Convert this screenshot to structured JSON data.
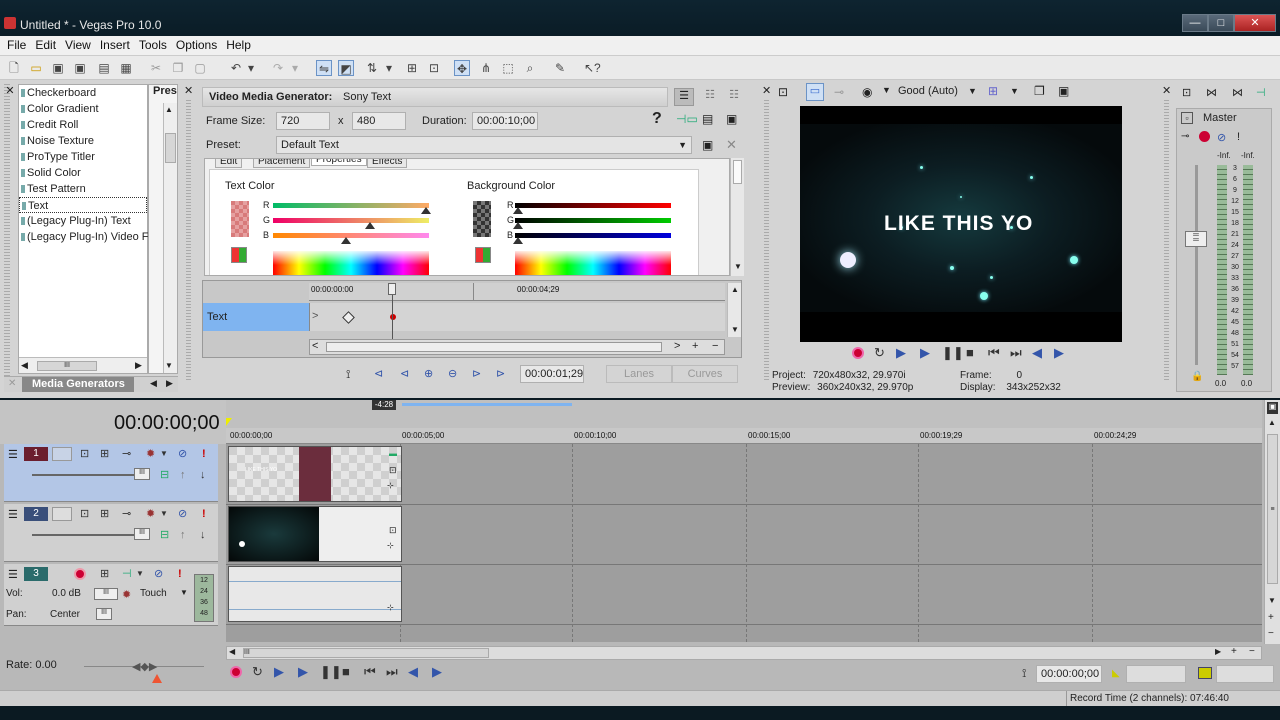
{
  "window": {
    "title": "Untitled * - Vegas Pro 10.0",
    "min": "—",
    "max": "□",
    "close": "✕"
  },
  "menu": [
    "File",
    "Edit",
    "View",
    "Insert",
    "Tools",
    "Options",
    "Help"
  ],
  "media_generators": {
    "items": [
      "Checkerboard",
      "Color Gradient",
      "Credit Roll",
      "Noise Texture",
      "ProType Titler",
      "Solid Color",
      "Test Pattern",
      "Text",
      "(Legacy Plug-In) Text",
      "(Legacy Plug-In) Video Fa"
    ],
    "selected": "Text",
    "presets_label": "Pres",
    "tab_label": "Media Generators"
  },
  "vmg": {
    "title": "Video Media Generator:",
    "generator": "Sony Text",
    "frame_size_label": "Frame Size:",
    "width": "720",
    "x": "x",
    "height": "480",
    "duration_label": "Duration:",
    "duration": "00:00:10;00",
    "preset_label": "Preset:",
    "preset": "Default Text",
    "tabs": [
      "Edit",
      "Placement",
      "Properties",
      "Effects"
    ],
    "text_color_label": "Text Color",
    "bg_color_label": "Background Color",
    "r": "R",
    "g": "G",
    "b": "B",
    "kf_time_start": "00:00:00:00",
    "kf_time_mid": "00:00:04;29",
    "kf_track_label": "Text",
    "cursor_time": "00:00:01;29",
    "lanes_label": "Lanes",
    "curves_label": "Curves"
  },
  "preview": {
    "quality": "Good (Auto)",
    "overlay_text": "LIKE THIS YO",
    "project_label": "Project:",
    "project_value": "720x480x32, 29.970i",
    "preview_label": "Preview:",
    "preview_value": "360x240x32, 29.970p",
    "frame_label": "Frame:",
    "frame_value": "0",
    "display_label": "Display:",
    "display_value": "343x252x32"
  },
  "master": {
    "label": "Master",
    "inf1": "-Inf.",
    "inf2": "-Inf.",
    "scale": [
      "3",
      "6",
      "9",
      "12",
      "15",
      "18",
      "21",
      "24",
      "27",
      "30",
      "33",
      "36",
      "39",
      "42",
      "45",
      "48",
      "51",
      "54",
      "57"
    ],
    "val1": "0.0",
    "val2": "0.0"
  },
  "timeline": {
    "timecode": "00:00:00;00",
    "region_len": "-4:28",
    "ruler": [
      "00:00:00;00",
      "00:00:05;00",
      "00:00:10;00",
      "00:00:15;00",
      "00:00:19;29",
      "00:00:24;29"
    ],
    "tracks": [
      {
        "num": "1"
      },
      {
        "num": "2"
      },
      {
        "num": "3"
      }
    ],
    "audio_vol_label": "Vol:",
    "audio_vol": "0.0 dB",
    "audio_pan_label": "Pan:",
    "audio_pan": "Center",
    "audio_mode": "Touch",
    "meter_scale": [
      "12",
      "24",
      "36",
      "48"
    ],
    "clip_text": "LIKE THIS YO",
    "rate": "Rate: 0.00",
    "cursor_pos": "00:00:00;00",
    "record_time": "Record Time (2 channels): 07:46:40"
  },
  "colors": {
    "accent": "#7fb4f0",
    "track1": "#6b1e2e",
    "track2": "#3a4f7a",
    "track3": "#2a6b6b"
  }
}
